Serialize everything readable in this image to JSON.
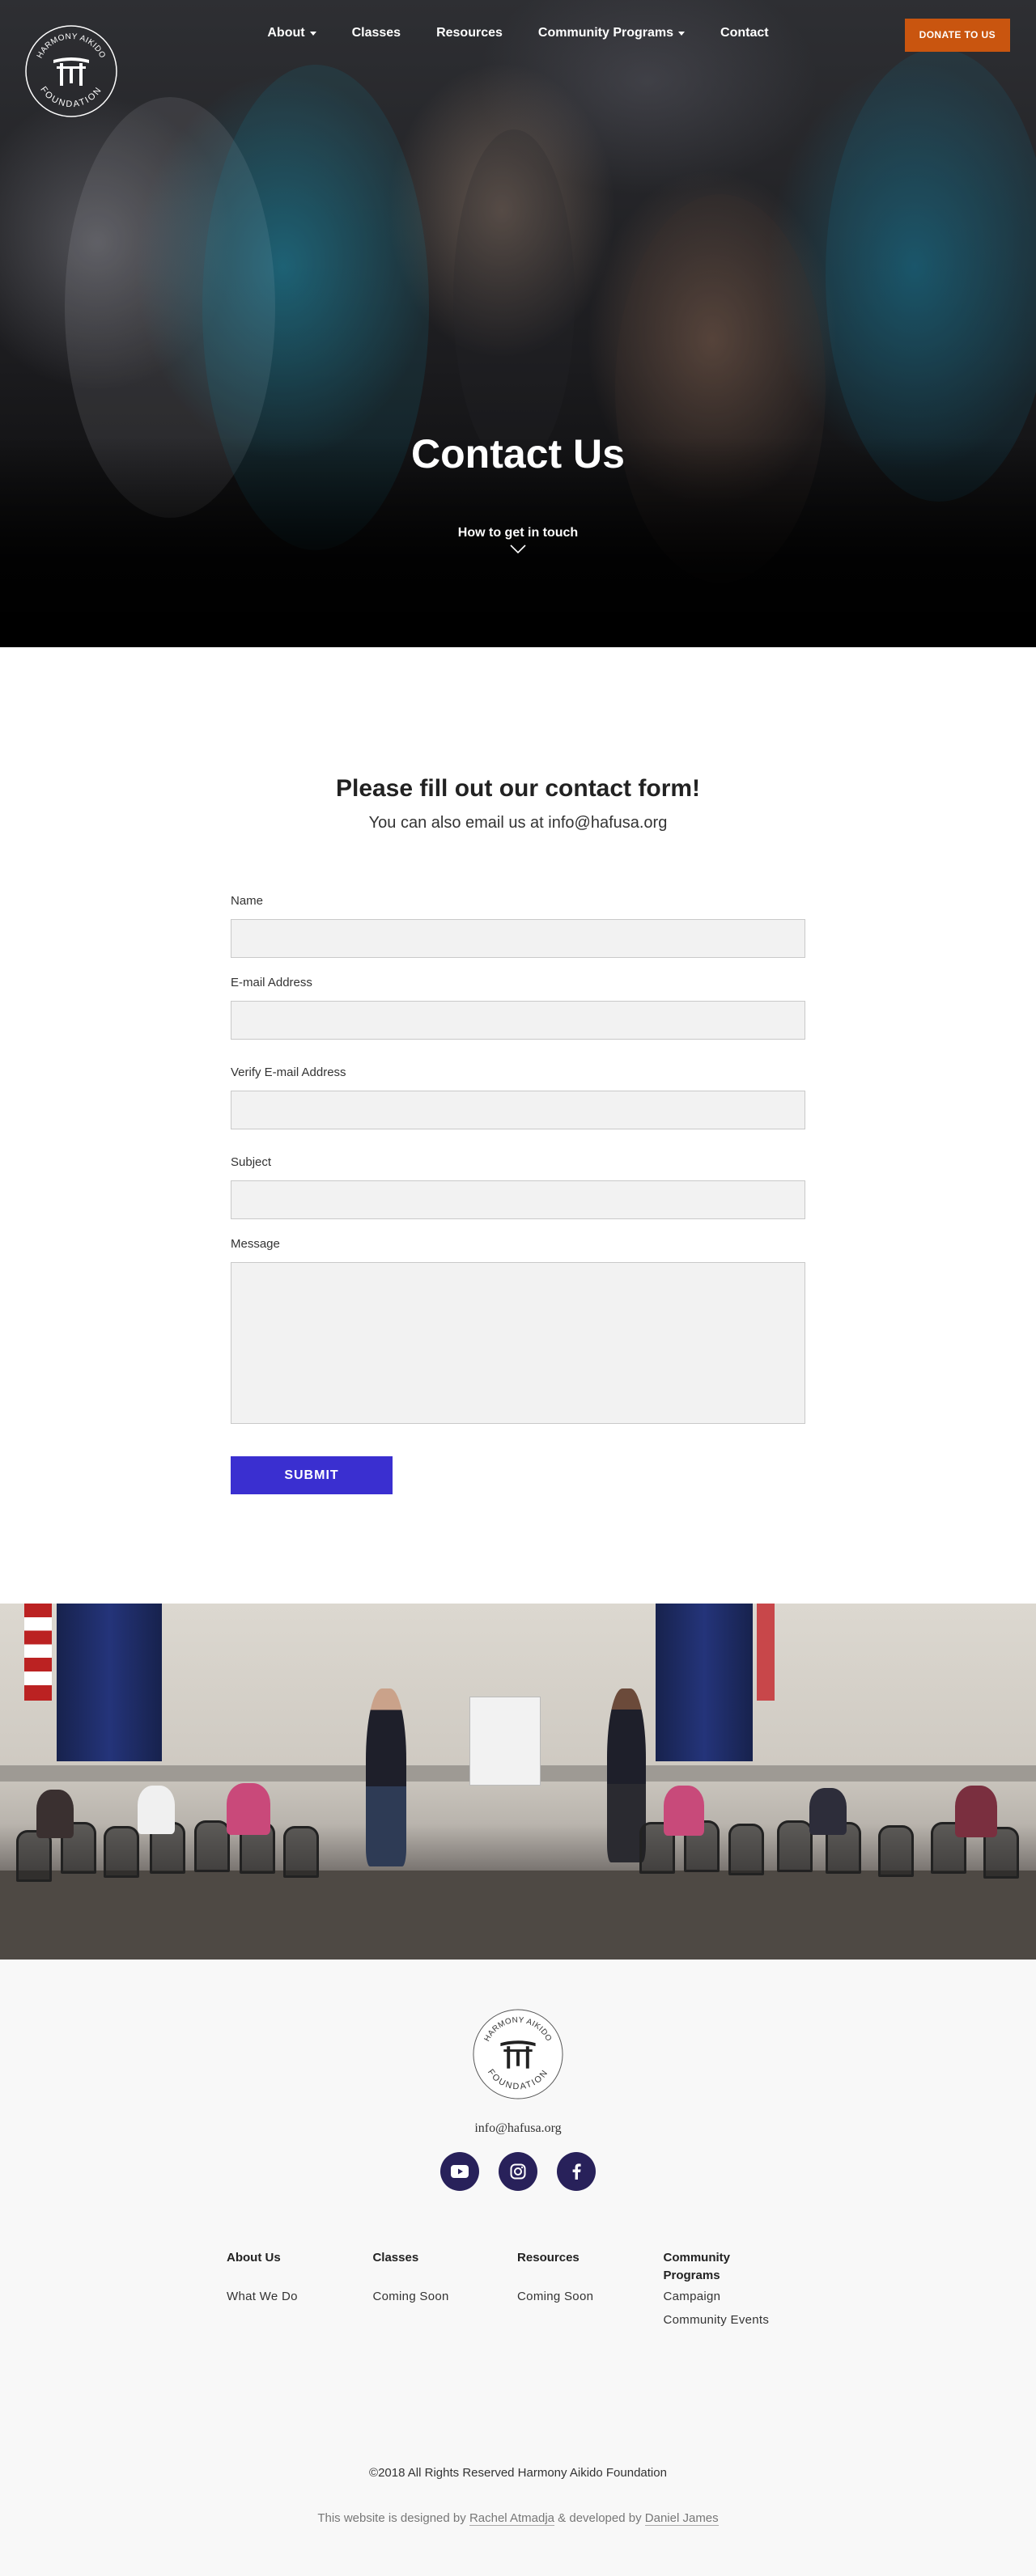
{
  "nav": {
    "items": [
      {
        "label": "About",
        "dropdown": true
      },
      {
        "label": "Classes",
        "dropdown": false
      },
      {
        "label": "Resources",
        "dropdown": false
      },
      {
        "label": "Community Programs",
        "dropdown": true
      },
      {
        "label": "Contact",
        "dropdown": false
      }
    ],
    "donate_label": "DONATE TO US",
    "donate_color": "#c9550f"
  },
  "logo": {
    "text_top": "HARMONY AIKIDO",
    "text_bottom": "FOUNDATION",
    "icon": "torii-gate-icon"
  },
  "hero": {
    "title": "Contact Us",
    "subtitle": "How to get in touch",
    "scroll_icon": "chevron-down-icon"
  },
  "form": {
    "title": "Please fill out our contact form!",
    "subtitle": "You can also email us at info@hafusa.org",
    "fields": {
      "name": {
        "label": "Name",
        "value": ""
      },
      "email": {
        "label": "E-mail Address",
        "value": ""
      },
      "verify_email": {
        "label": "Verify E-mail Address",
        "value": ""
      },
      "subject": {
        "label": "Subject",
        "value": ""
      },
      "message": {
        "label": "Message",
        "value": ""
      }
    },
    "submit_label": "SUBMIT",
    "submit_color": "#3a2fd0"
  },
  "footer": {
    "email": "info@hafusa.org",
    "socials": [
      "youtube-icon",
      "instagram-icon",
      "facebook-icon"
    ],
    "social_color": "#28215a",
    "columns": [
      {
        "title": "About Us",
        "links": [
          "What We Do"
        ]
      },
      {
        "title": "Classes",
        "links": [
          "Coming Soon"
        ]
      },
      {
        "title": "Resources",
        "links": [
          "Coming Soon"
        ]
      },
      {
        "title": "Community Programs",
        "links": [
          "Campaign",
          "Community Events"
        ]
      }
    ],
    "copyright": "©2018  All Rights Reserved  Harmony Aikido Foundation",
    "credit_prefix": "This website is designed by",
    "designer": "Rachel Atmadja",
    "credit_mid": "&",
    "credit_dev": "developed by",
    "developer": "Daniel James"
  }
}
